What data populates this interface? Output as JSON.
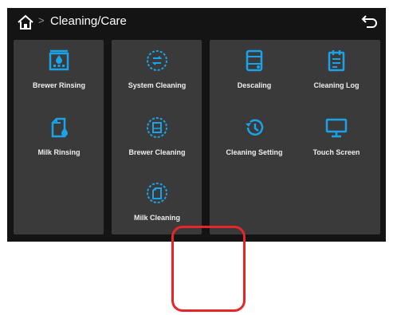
{
  "header": {
    "title": "Cleaning/Care",
    "separator": ">",
    "home_icon": "home-icon",
    "back_icon": "back-arrow-icon"
  },
  "tiles": [
    {
      "label": "Brewer Rinsing",
      "icon": "brewer-rinsing-icon"
    },
    {
      "label": "Milk Rinsing",
      "icon": "milk-rinsing-icon"
    },
    {
      "label": "System Cleaning",
      "icon": "system-cleaning-icon"
    },
    {
      "label": "Brewer Cleaning",
      "icon": "brewer-cleaning-icon"
    },
    {
      "label": "Milk Cleaning",
      "icon": "milk-cleaning-icon"
    },
    {
      "label": "Descaling",
      "icon": "descaling-icon"
    },
    {
      "label": "Cleaning Log",
      "icon": "cleaning-log-icon"
    },
    {
      "label": "Cleaning Setting",
      "icon": "cleaning-setting-icon"
    },
    {
      "label": "Touch Screen",
      "icon": "touch-screen-icon"
    }
  ],
  "colors": {
    "accent": "#1aa3e8",
    "screen_bg": "#141414",
    "panel_bg": "#3a3a3a",
    "highlight": "#e8262a"
  }
}
